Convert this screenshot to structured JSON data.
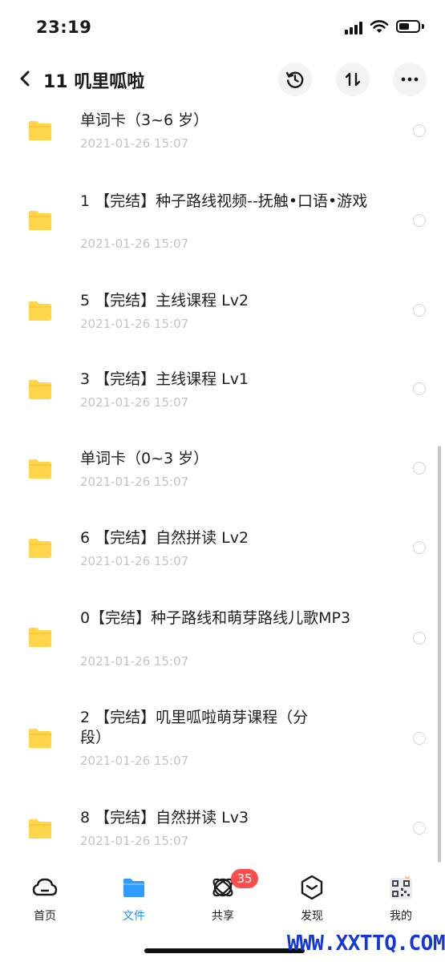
{
  "status_bar": {
    "time": "23:19"
  },
  "header": {
    "title": "11 叽里呱啦",
    "back_icon": "chevron-left-icon",
    "history_icon": "history-icon",
    "sort_icon": "sort-icon",
    "more_icon": "more-icon"
  },
  "files": [
    {
      "name": "单词卡（3~6 岁）",
      "date": "2021-01-26 15:07"
    },
    {
      "name": "1 【完结】种子路线视频--抚触•口语•游戏",
      "date": "2021-01-26 15:07"
    },
    {
      "name": "5 【完结】主线课程 Lv2",
      "date": "2021-01-26 15:07"
    },
    {
      "name": "3 【完结】主线课程 Lv1",
      "date": "2021-01-26 15:07"
    },
    {
      "name": "单词卡（0~3 岁）",
      "date": "2021-01-26 15:07"
    },
    {
      "name": "6 【完结】自然拼读 Lv2",
      "date": "2021-01-26 15:07"
    },
    {
      "name": "0【完结】种子路线和萌芽路线儿歌MP3",
      "date": "2021-01-26 15:07"
    },
    {
      "name": "2 【完结】叽里呱啦萌芽课程（分段）",
      "date": "2021-01-26 15:07"
    },
    {
      "name": "8 【完结】自然拼读 Lv3",
      "date": "2021-01-26 15:07"
    }
  ],
  "tabbar": {
    "tabs": [
      {
        "label": "首页",
        "icon": "cloud-icon"
      },
      {
        "label": "文件",
        "icon": "folder-icon"
      },
      {
        "label": "共享",
        "icon": "share-orbit-icon"
      },
      {
        "label": "发现",
        "icon": "discover-icon"
      },
      {
        "label": "我的",
        "icon": "avatar-qr-icon"
      }
    ],
    "share_badge": "35",
    "active_index": 1
  },
  "colors": {
    "accent": "#1e90ff",
    "folder": "#ffd54a",
    "badge": "#ff4d4f",
    "date": "#c2c4c8"
  },
  "watermark": "WWW.XXTTQ.COM"
}
